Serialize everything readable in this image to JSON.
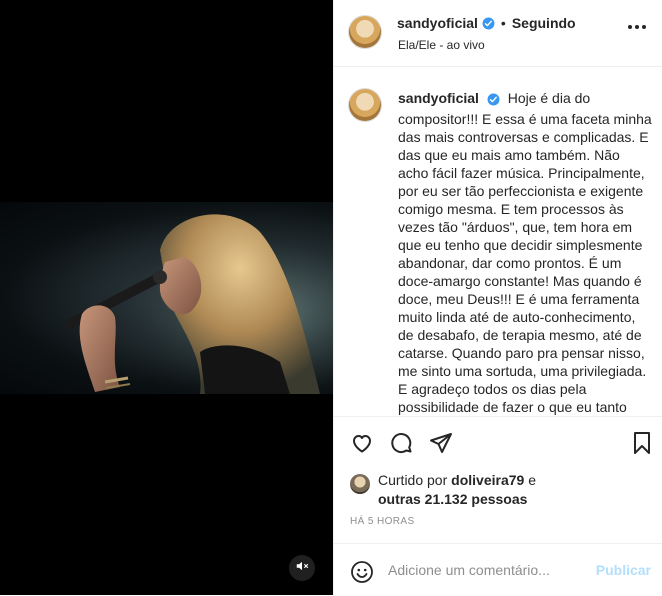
{
  "post": {
    "username": "sandyoficial",
    "follow_status": "Seguindo",
    "subtitle": "Ela/Ele - ao vivo",
    "caption": "Hoje é dia do compositor!!! E essa é uma faceta minha das mais controversas e complicadas. E das que eu mais amo também. Não acho fácil fazer música. Principalmente, por eu ser tão perfeccionista e exigente comigo mesma. E tem processos às vezes tão \"árduos\", que, tem hora em que eu tenho que decidir simplesmente abandonar, dar como prontos. É um doce-amargo constante! Mas quando é doce, meu Deus!!! E é uma ferramenta muito linda até de auto-conhecimento, de desabafo, de terapia mesmo, até de catarse. Quando paro pra pensar nisso, me sinto uma sortuda, uma privilegiada. E agradeço todos os dias pela possibilidade de fazer o que eu tanto",
    "likes": {
      "prefix": "Curtido por",
      "user": "doliveira79",
      "conjunction": "e",
      "others": "outras 21.132 pessoas"
    },
    "time": "HÁ 5 HORAS"
  },
  "comment": {
    "placeholder": "Adicione um comentário...",
    "publish_label": "Publicar"
  },
  "icons": {
    "verified": "verified-badge-icon",
    "more": "more-options-icon",
    "like": "heart-icon",
    "comment": "comment-bubble-icon",
    "share": "paper-plane-icon",
    "save": "bookmark-icon",
    "emoji": "smiley-icon",
    "mute": "speaker-muted-icon"
  },
  "colors": {
    "verified": "#3897f0",
    "publish_disabled": "#b2dffc",
    "muted_text": "#8e8e8e"
  }
}
